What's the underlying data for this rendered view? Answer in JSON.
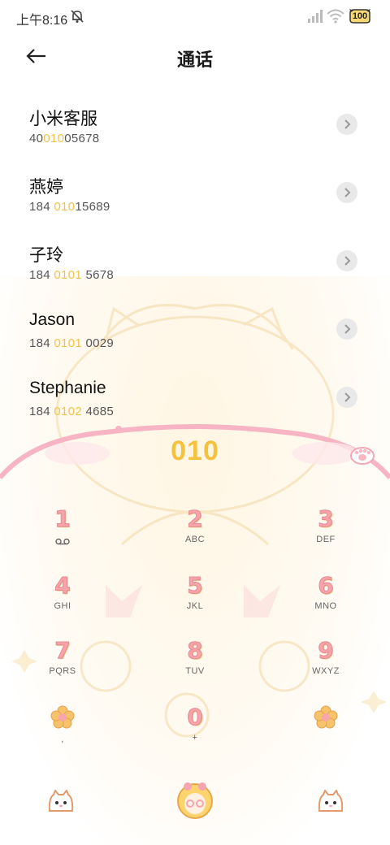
{
  "status_bar": {
    "time": "上午8:16",
    "battery": "100",
    "icons": [
      "mute-bell-icon",
      "signal-icon",
      "wifi-icon",
      "battery-icon"
    ]
  },
  "header": {
    "title": "通话",
    "back_icon": "arrow-left-icon"
  },
  "contacts": [
    {
      "name": "小米客服",
      "number_pre": "40",
      "number_match": "010",
      "number_post": "05678"
    },
    {
      "name": "燕婷",
      "number_pre": "184 ",
      "number_match": "010",
      "number_post": "15689"
    },
    {
      "name": "子玲",
      "number_pre": "184 ",
      "number_match": "0101",
      "number_post": " 5678"
    },
    {
      "name": "Jason",
      "number_pre": "184 ",
      "number_match": "0101",
      "number_post": " 0029"
    },
    {
      "name": "Stephanie",
      "number_pre": "184 ",
      "number_match": "0102",
      "number_post": " 4685"
    }
  ],
  "dialer": {
    "input": "010",
    "keys": [
      {
        "digit": "1",
        "letters": ""
      },
      {
        "digit": "2",
        "letters": "ABC"
      },
      {
        "digit": "3",
        "letters": "DEF"
      },
      {
        "digit": "4",
        "letters": "GHI"
      },
      {
        "digit": "5",
        "letters": "JKL"
      },
      {
        "digit": "6",
        "letters": "MNO"
      },
      {
        "digit": "7",
        "letters": "PQRS"
      },
      {
        "digit": "8",
        "letters": "TUV"
      },
      {
        "digit": "9",
        "letters": "WXYZ"
      },
      {
        "digit": "",
        "letters": ","
      },
      {
        "digit": "0",
        "letters": "+"
      },
      {
        "digit": "",
        "letters": ""
      }
    ]
  },
  "colors": {
    "accent": "#f4c23e",
    "pink": "#f6a4a9",
    "chevron_bg": "#e9e9e9"
  }
}
